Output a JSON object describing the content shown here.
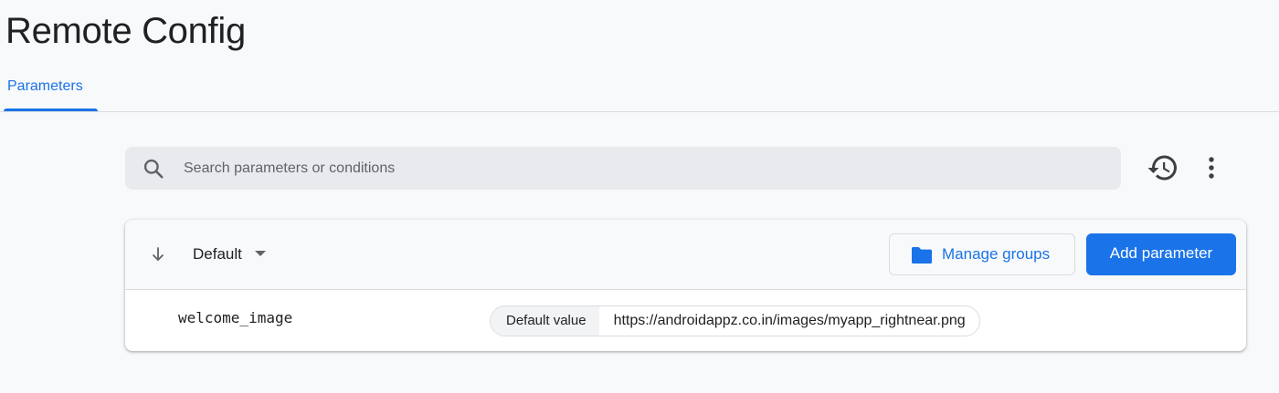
{
  "page": {
    "title": "Remote Config"
  },
  "tabs": [
    {
      "label": "Parameters",
      "active": true
    }
  ],
  "search": {
    "placeholder": "Search parameters or conditions",
    "value": ""
  },
  "toolbar_icons": [
    "history-icon",
    "more-vert-icon"
  ],
  "parameters_card": {
    "sort_icon": "arrow-down-icon",
    "group_select": {
      "selected": "Default"
    },
    "manage_groups_label": "Manage groups",
    "add_parameter_label": "Add parameter",
    "rows": [
      {
        "key": "welcome_image",
        "value_label": "Default value",
        "value": "https://androidappz.co.in/images/myapp_rightnear.png"
      }
    ]
  },
  "colors": {
    "accent": "#1a73e8",
    "background": "#f8f9fa",
    "search_bg": "#e8eaed",
    "text": "#202124",
    "icon": "#5f6368"
  }
}
